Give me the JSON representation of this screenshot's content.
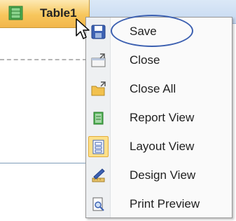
{
  "document_tab": {
    "label": "Table1",
    "icon": "table-icon"
  },
  "context_menu": {
    "items": [
      {
        "label": "Save",
        "icon": "save-disk-icon"
      },
      {
        "label": "Close",
        "icon": "close-window-icon"
      },
      {
        "label": "Close All",
        "icon": "close-all-folder-icon"
      },
      {
        "label": "Report View",
        "icon": "report-view-icon"
      },
      {
        "label": "Layout View",
        "icon": "layout-view-icon"
      },
      {
        "label": "Design View",
        "icon": "design-view-icon"
      },
      {
        "label": "Print Preview",
        "icon": "print-preview-icon"
      }
    ]
  },
  "colors": {
    "tab": "#f7c65c",
    "highlight": "#fde08a",
    "annotation": "#3b5fb0"
  }
}
